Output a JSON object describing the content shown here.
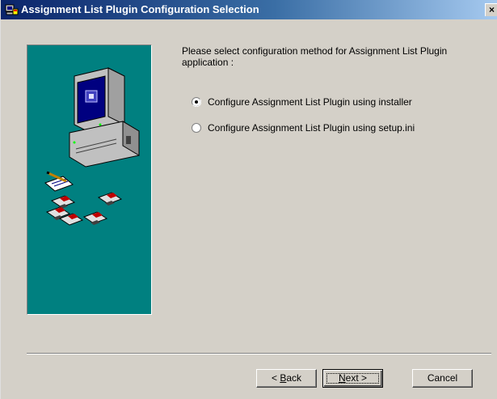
{
  "window": {
    "title": "Assignment List Plugin Configuration Selection",
    "close_glyph": "×"
  },
  "main": {
    "prompt": "Please select configuration method for  Assignment List Plugin application :",
    "options": [
      {
        "label": "Configure Assignment List Plugin using installer",
        "selected": true
      },
      {
        "label": "Configure Assignment List Plugin using setup.ini",
        "selected": false
      }
    ]
  },
  "buttons": {
    "back": {
      "prefix": "< ",
      "mnemonic": "B",
      "rest": "ack"
    },
    "next": {
      "mnemonic": "N",
      "rest": "ext >"
    },
    "cancel": "Cancel"
  },
  "icons": {
    "app": "installer-icon",
    "graphic": "computer-with-disks-illustration"
  },
  "colors": {
    "title_start": "#0a246a",
    "title_end": "#a6caf0",
    "panel_teal": "#008080",
    "dialog_bg": "#d4d0c8"
  }
}
